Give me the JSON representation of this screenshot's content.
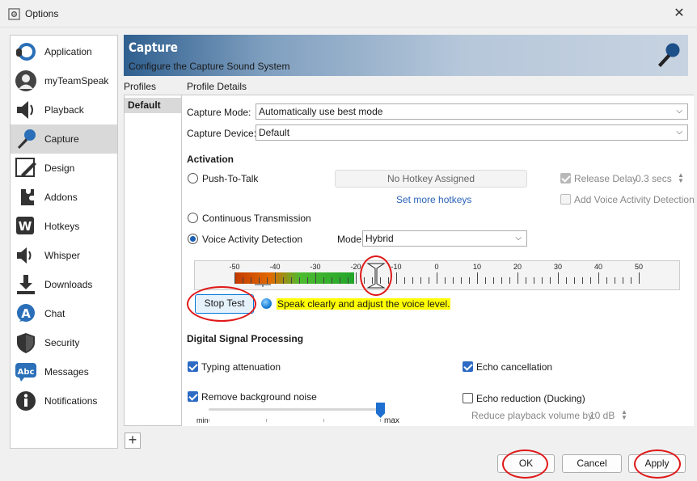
{
  "window": {
    "title": "Options",
    "close_glyph": "✕"
  },
  "sidebar": {
    "items": [
      {
        "label": "Application",
        "icon": "headset-logo-icon"
      },
      {
        "label": "myTeamSpeak",
        "icon": "user-icon"
      },
      {
        "label": "Playback",
        "icon": "speaker-icon"
      },
      {
        "label": "Capture",
        "icon": "microphone-icon",
        "active": true
      },
      {
        "label": "Design",
        "icon": "pencil-icon"
      },
      {
        "label": "Addons",
        "icon": "puzzle-icon"
      },
      {
        "label": "Hotkeys",
        "icon": "keyboard-w-icon"
      },
      {
        "label": "Whisper",
        "icon": "whisper-speaker-icon"
      },
      {
        "label": "Downloads",
        "icon": "download-icon"
      },
      {
        "label": "Chat",
        "icon": "chat-a-icon"
      },
      {
        "label": "Security",
        "icon": "shield-icon"
      },
      {
        "label": "Messages",
        "icon": "messages-abc-icon"
      },
      {
        "label": "Notifications",
        "icon": "info-icon"
      }
    ]
  },
  "header": {
    "title": "Capture",
    "subtitle": "Configure the Capture Sound System"
  },
  "profiles": {
    "heading": "Profiles",
    "items": [
      "Default"
    ]
  },
  "details": {
    "heading": "Profile Details",
    "capture_mode": {
      "label": "Capture Mode:",
      "value": "Automatically use best mode"
    },
    "capture_device": {
      "label": "Capture Device:",
      "value": "Default"
    }
  },
  "activation": {
    "title": "Activation",
    "push_to_talk": "Push-To-Talk",
    "hotkey_button": "No Hotkey Assigned",
    "set_more_hotkeys": "Set more hotkeys",
    "release_delay_label": "Release Delay",
    "release_delay_value": "0.3 secs",
    "add_vad_label": "Add Voice Activity Detection",
    "continuous": "Continuous Transmission",
    "vad": "Voice Activity Detection",
    "mode_label": "Mode",
    "mode_value": "Hybrid",
    "selected": "vad"
  },
  "meter": {
    "scale": [
      "-50",
      "-40",
      "-30",
      "-20",
      "-10",
      "0",
      "10",
      "20",
      "30",
      "40",
      "50"
    ],
    "level_db": -20,
    "threshold_db": -15,
    "colors": {
      "low": "#d04000",
      "mid": "#2fb02f"
    }
  },
  "test": {
    "stop_test_label": "Stop Test",
    "hint": "Speak clearly and adjust the voice level."
  },
  "dsp": {
    "title": "Digital Signal Processing",
    "typing_attenuation": {
      "label": "Typing attenuation",
      "checked": true
    },
    "remove_noise": {
      "label": "Remove background noise",
      "checked": true,
      "level_fraction": 1.0
    },
    "slider_min": "min",
    "slider_max": "max",
    "echo_cancellation": {
      "label": "Echo cancellation",
      "checked": true
    },
    "echo_reduction": {
      "label": "Echo reduction (Ducking)",
      "checked": false
    },
    "reduce_label": "Reduce playback volume by:",
    "reduce_value": "10 dB"
  },
  "buttons": {
    "ok": "OK",
    "cancel": "Cancel",
    "apply": "Apply",
    "add_profile": "+"
  },
  "colors": {
    "accent": "#0078d7",
    "annotation_red": "#e01818",
    "highlight": "#ffff00"
  }
}
